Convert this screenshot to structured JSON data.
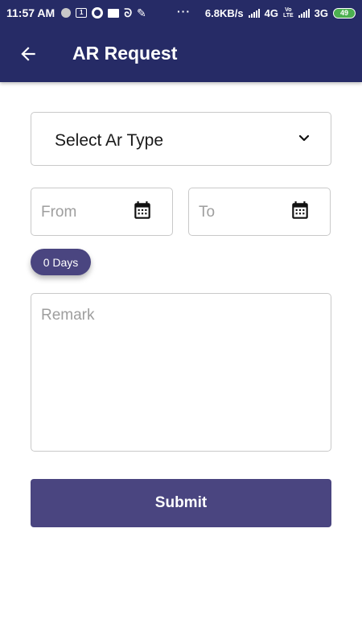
{
  "status_bar": {
    "time": "11:57 AM",
    "network_speed": "6.8KB/s",
    "network_4g": "4G",
    "volte_top": "Vo",
    "volte_bottom": "LTE",
    "network_3g": "3G",
    "battery": "49"
  },
  "header": {
    "title": "AR Request",
    "back_icon": "arrow-left-icon"
  },
  "form": {
    "ar_type": {
      "label": "Select Ar Type",
      "icon": "chevron-down-icon"
    },
    "from": {
      "placeholder": "From",
      "icon": "calendar-icon"
    },
    "to": {
      "placeholder": "To",
      "icon": "calendar-icon"
    },
    "days_chip": "0 Days",
    "remark": {
      "placeholder": "Remark"
    },
    "submit_label": "Submit"
  },
  "colors": {
    "header_bg": "#262b66",
    "accent": "#4a4580",
    "border": "#c9c9c9",
    "placeholder": "#9e9e9e"
  }
}
